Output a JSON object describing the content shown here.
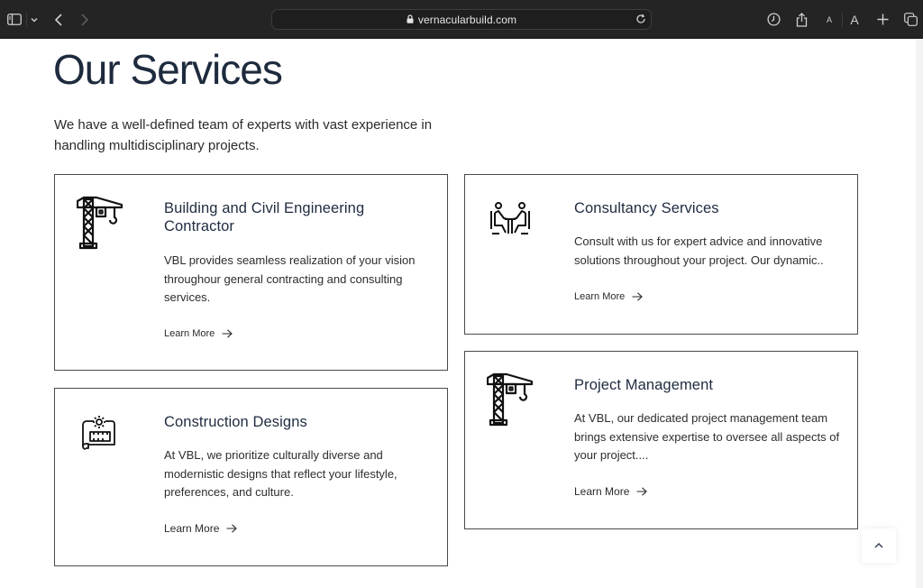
{
  "browser": {
    "url": "vernacularbuild.com",
    "icons": {
      "sidebar": "sidebar-icon",
      "tab_overview_menu": "chevron-down-icon",
      "back": "back-arrow-icon",
      "forward": "forward-arrow-icon",
      "lock": "lock-icon",
      "reload": "reload-icon",
      "history": "clock-icon",
      "share": "share-icon",
      "text_smaller": "A",
      "text_larger": "A",
      "new_tab": "plus-icon",
      "tabs": "tabs-icon"
    }
  },
  "page": {
    "title": "Our Services",
    "intro": "We have a well-defined team of experts with vast experience in handling multidisciplinary projects.",
    "services": [
      {
        "title": "Building and Civil Engineering Contractor",
        "description": "VBL provides seamless realization of your vision throughour general contracting and consulting services.",
        "link": "Learn More",
        "icon": "crane-icon"
      },
      {
        "title": "Consultancy Services",
        "description": "Consult with us for expert advice and innovative solutions throughout your project. Our dynamic..",
        "link": "Learn More",
        "icon": "consultation-icon"
      },
      {
        "title": "Construction Designs",
        "description": "At VBL, we prioritize culturally diverse and modernistic designs that reflect your lifestyle, preferences, and culture.",
        "link": "Learn More",
        "icon": "blueprint-gear-icon"
      },
      {
        "title": "Project Management",
        "description": "At VBL, our dedicated project management team brings extensive expertise to oversee all aspects of your project....",
        "link": "Learn More",
        "icon": "crane-icon"
      }
    ],
    "back_to_top_icon": "chevron-up-icon"
  },
  "colors": {
    "toolbar_bg": "#242424",
    "heading": "#1e2a3d",
    "card_border": "#4a4a4a"
  }
}
